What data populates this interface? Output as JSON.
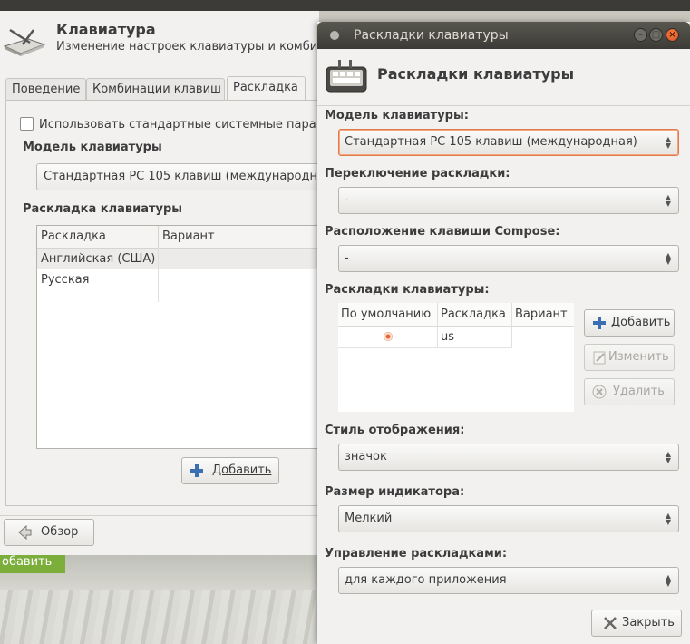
{
  "back_window": {
    "title": "Клавиатура",
    "subtitle": "Изменение настроек клавиатуры и комби",
    "tabs": [
      "Поведение",
      "Комбинации клавиш",
      "Раскладка"
    ],
    "use_system_checkbox": "Использовать стандартные системные пара",
    "model_label": "Модель клавиатуры",
    "model_value": "Стандартная PC 105 клавиш (международн",
    "layouts_label": "Раскладка клавиатуры",
    "table_headers": [
      "Раскладка",
      "Вариант"
    ],
    "table_rows": [
      "Английская (США)",
      "Русская"
    ],
    "add_button": "Добавить",
    "overview_button": "Обзор"
  },
  "desktop": {
    "green_button": "обавить"
  },
  "dialog": {
    "title": "Раскладки клавиатуры",
    "heading": "Раскладки клавиатуры",
    "model": {
      "label": "Модель клавиатуры:",
      "value": "Стандартная PC 105 клавиш (международная)"
    },
    "switch": {
      "label": "Переключение раскладки:",
      "value": "-"
    },
    "compose": {
      "label": "Расположение клавиши Compose:",
      "value": "-"
    },
    "layouts": {
      "label": "Раскладки клавиатуры:",
      "headers": [
        "По умолчанию",
        "Раскладка",
        "Вариант"
      ],
      "rows": [
        {
          "layout": "us",
          "variant": ""
        }
      ],
      "add_button": "Добавить",
      "edit_button": "Изменить",
      "remove_button": "Удалить"
    },
    "display_style": {
      "label": "Стиль отображения:",
      "value": "значок"
    },
    "indicator_size": {
      "label": "Размер индикатора:",
      "value": "Мелкий"
    },
    "layout_management": {
      "label": "Управление раскладками:",
      "value": "для каждого приложения"
    },
    "close_button": "Закрыть"
  },
  "colors": {
    "titlebar": "#3c3b37",
    "accent_close": "#e2572a",
    "focus_border": "#e07a4a",
    "desktop_green": "#7cae3b"
  }
}
